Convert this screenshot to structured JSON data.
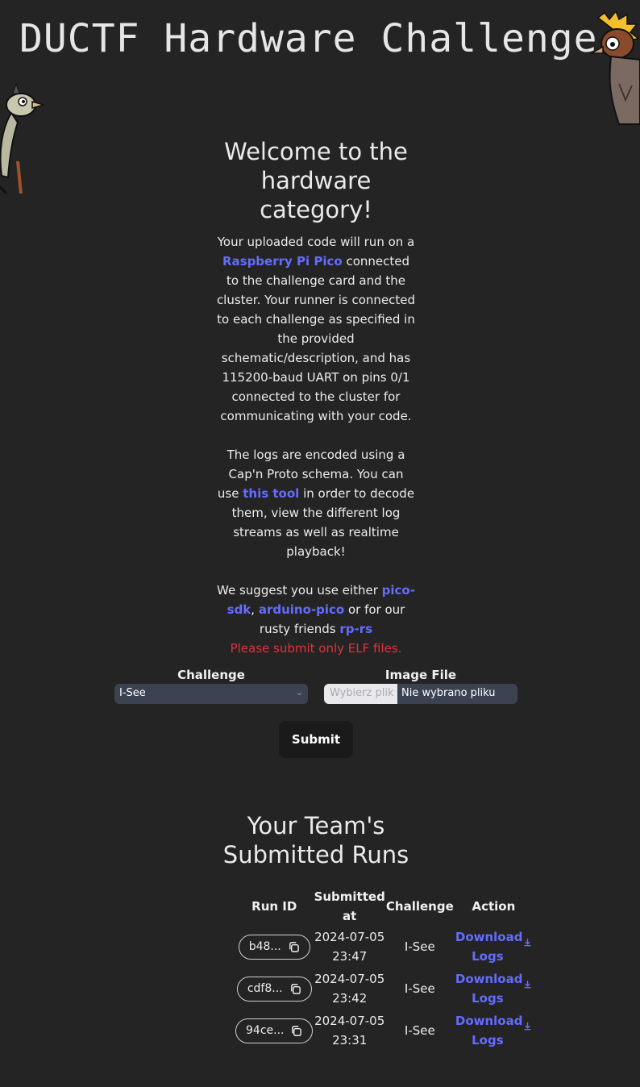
{
  "site": {
    "title": "DUCTF Hardware Challenge"
  },
  "intro": {
    "heading": "Welcome to the hardware category!",
    "p1": {
      "t1": "Your uploaded code will run on a ",
      "link1": "Raspberry Pi Pico",
      "t2": " connected to the challenge card and the cluster. Your runner is connected to each challenge as specified in the provided schematic/description, and has 115200-baud UART on pins 0/1 connected to the cluster for communicating with your code."
    },
    "p2": {
      "t1": "The logs are encoded using a Cap'n Proto schema. You can use ",
      "link1": "this tool",
      "t2": " in order to decode them, view the different log streams as well as realtime playback!"
    },
    "p3": {
      "t1": "We suggest you use either ",
      "link1": "pico-sdk",
      "t2": ", ",
      "link2": "arduino-pico",
      "t3": " or for our rusty friends ",
      "link3": "rp-rs"
    },
    "warning": "Please submit only ELF files."
  },
  "form": {
    "challenge_label": "Challenge",
    "challenge_value": "I-See",
    "image_label": "Image File",
    "file_button": "Wybierz plik",
    "file_status": "Nie wybrano pliku",
    "submit_label": "Submit"
  },
  "runs": {
    "heading": "Your Team's Submitted Runs",
    "headers": {
      "run_id": "Run ID",
      "submitted_at": "Submitted at",
      "challenge": "Challenge",
      "action": "Action"
    },
    "rows": [
      {
        "id": "b48...",
        "submitted": "2024-07-05 23:47",
        "challenge": "I-See",
        "action": "Download Logs"
      },
      {
        "id": "cdf8...",
        "submitted": "2024-07-05 23:42",
        "challenge": "I-See",
        "action": "Download Logs"
      },
      {
        "id": "94ce...",
        "submitted": "2024-07-05 23:31",
        "challenge": "I-See",
        "action": "Download Logs"
      }
    ]
  },
  "colors": {
    "background": "#242424",
    "link": "#646cff",
    "warning": "#e0333b",
    "input_bg": "#3b4252"
  },
  "icons": {
    "copy": "copy-icon",
    "download": "download-icon",
    "dropdown": "chevron-down-icon"
  }
}
